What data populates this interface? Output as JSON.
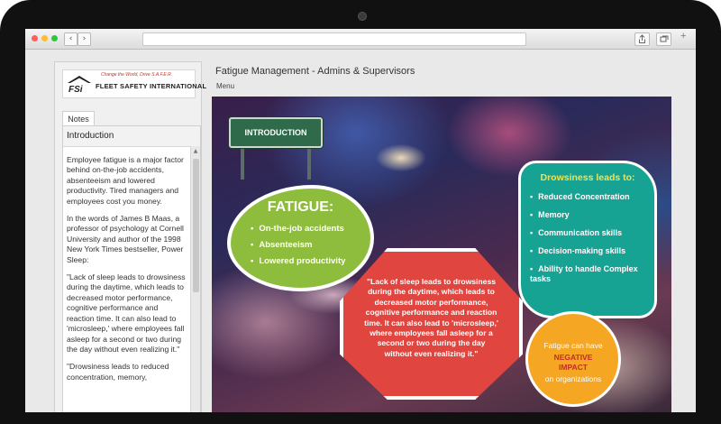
{
  "browser": {
    "back_icon": "chevron-left-icon",
    "forward_icon": "chevron-right-icon",
    "traffic_light_colors": [
      "#ff5f57",
      "#febc2e",
      "#28c840"
    ]
  },
  "logo": {
    "tagline": "Change the World, Drive S.A.F.E.R.",
    "name": "FLEET SAFETY INTERNATIONAL"
  },
  "course": {
    "title": "Fatigue Management - Admins & Supervisors",
    "menu_label": "Menu"
  },
  "notes": {
    "tab_label": "Notes",
    "heading": "Introduction",
    "paragraphs": [
      "Employee fatigue is a major factor behind on-the-job accidents, absenteeism and lowered productivity. Tired managers and employees cost you money.",
      "In the words of James B Maas, a professor of psychology at Cornell University and author of the 1998 New York Times bestseller, Power Sleep:",
      "\"Lack of sleep leads to drowsiness during the daytime, which leads to decreased motor performance, cognitive performance and reaction time. It can also lead to 'microsleep,' where employees fall asleep for a second or two during the day without even realizing it.\"",
      "\"Drowsiness leads to reduced concentration, memory,"
    ]
  },
  "slide": {
    "sign_label": "INTRODUCTION",
    "fatigue": {
      "title": "FATIGUE:",
      "items": [
        "On-the-job accidents",
        "Absenteeism",
        "Lowered productivity"
      ]
    },
    "quote": "\"Lack of sleep leads to drowsiness during the daytime, which leads to decreased motor performance, cognitive performance and reaction time. It can also lead to 'microsleep,' where employees fall asleep for a second or two during the day without even realizing it.\"",
    "drowsiness": {
      "title": "Drowsiness leads to:",
      "items": [
        "Reduced Concentration",
        "Memory",
        "Communication skills",
        "Decision-making skills",
        "Ability to handle Complex tasks"
      ]
    },
    "impact": {
      "line1": "Fatigue can have",
      "line2": "NEGATIVE",
      "line3": "IMPACT",
      "line4": "on organizations"
    },
    "colors": {
      "fatigue_green": "#8ebd3e",
      "quote_red": "#e0463f",
      "drowsy_teal": "#17a394",
      "impact_orange": "#f5a623",
      "sign_green": "#2f6b4a"
    }
  }
}
